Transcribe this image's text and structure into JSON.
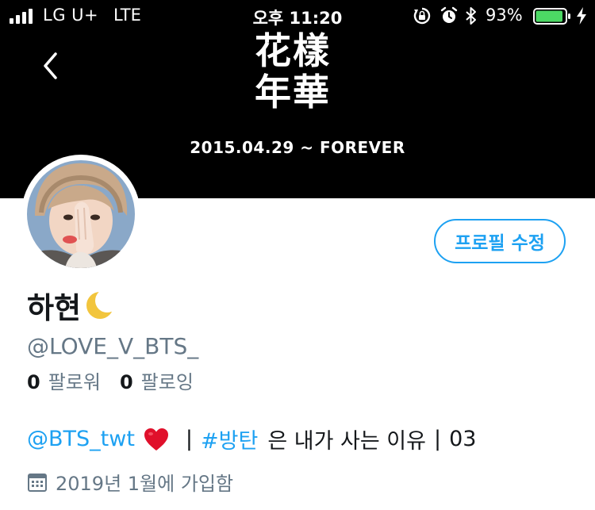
{
  "status_bar": {
    "carrier": "LG U+",
    "network": "LTE",
    "time": "오후 11:20",
    "battery_percent": "93%",
    "battery_level": 0.93,
    "icons": [
      "signal-icon",
      "rotation-lock-icon",
      "alarm-icon",
      "bluetooth-icon",
      "battery-icon",
      "charging-bolt-icon"
    ]
  },
  "header": {
    "back_icon": "chevron-left-icon",
    "banner_title_line1": "花樣",
    "banner_title_line2": "年華",
    "banner_date": "2015.04.29 ~ FOREVER"
  },
  "profile": {
    "edit_button_label": "프로필 수정",
    "display_name": "하현",
    "name_emoji": "crescent-moon-icon",
    "handle": "@LOVE_V_BTS_",
    "following_count": "0",
    "following_label": "팔로워",
    "followers_count": "0",
    "followers_label": "팔로잉",
    "bio": {
      "mention": "@BTS_twt",
      "heart": "red-heart-icon",
      "sep1": "|",
      "hashtag": "#방탄",
      "text": "은 내가 사는 이유",
      "sep2": "|",
      "suffix": "03"
    },
    "joined_icon": "calendar-icon",
    "joined": "2019년 1월에 가입함"
  },
  "colors": {
    "accent": "#1da1f2",
    "banner": "#000000",
    "secondary_text": "#657786",
    "battery_fill": "#4cd964",
    "heart": "#e0102b"
  }
}
